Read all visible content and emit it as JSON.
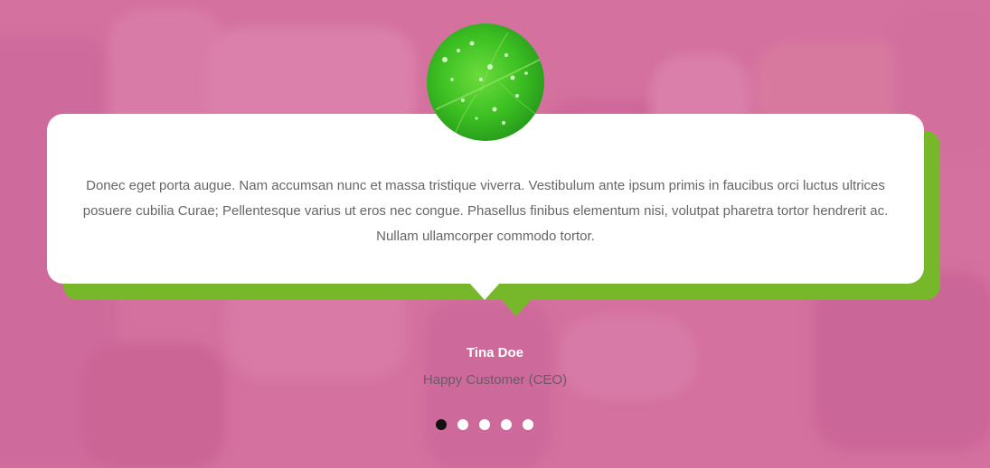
{
  "testimonial": {
    "quote": "Donec eget porta augue. Nam accumsan nunc et massa tristique viverra. Vestibulum ante ipsum primis in faucibus orci luctus ultrices posuere cubilia Curae; Pellentesque varius ut eros nec congue. Phasellus finibus elementum nisi, volutpat pharetra tortor hendrerit ac. Nullam ullamcorper commodo tortor.",
    "author_name": "Tina Doe",
    "author_role": "Happy Customer (CEO)",
    "avatar": "green-leaf-image"
  },
  "carousel": {
    "slide_count": 5,
    "active_index": 0
  },
  "colors": {
    "background": "#d2739e",
    "card": "#ffffff",
    "accent_shadow": "#77b82a",
    "active_dot": "#111111",
    "inactive_dot": "#ffffff"
  }
}
